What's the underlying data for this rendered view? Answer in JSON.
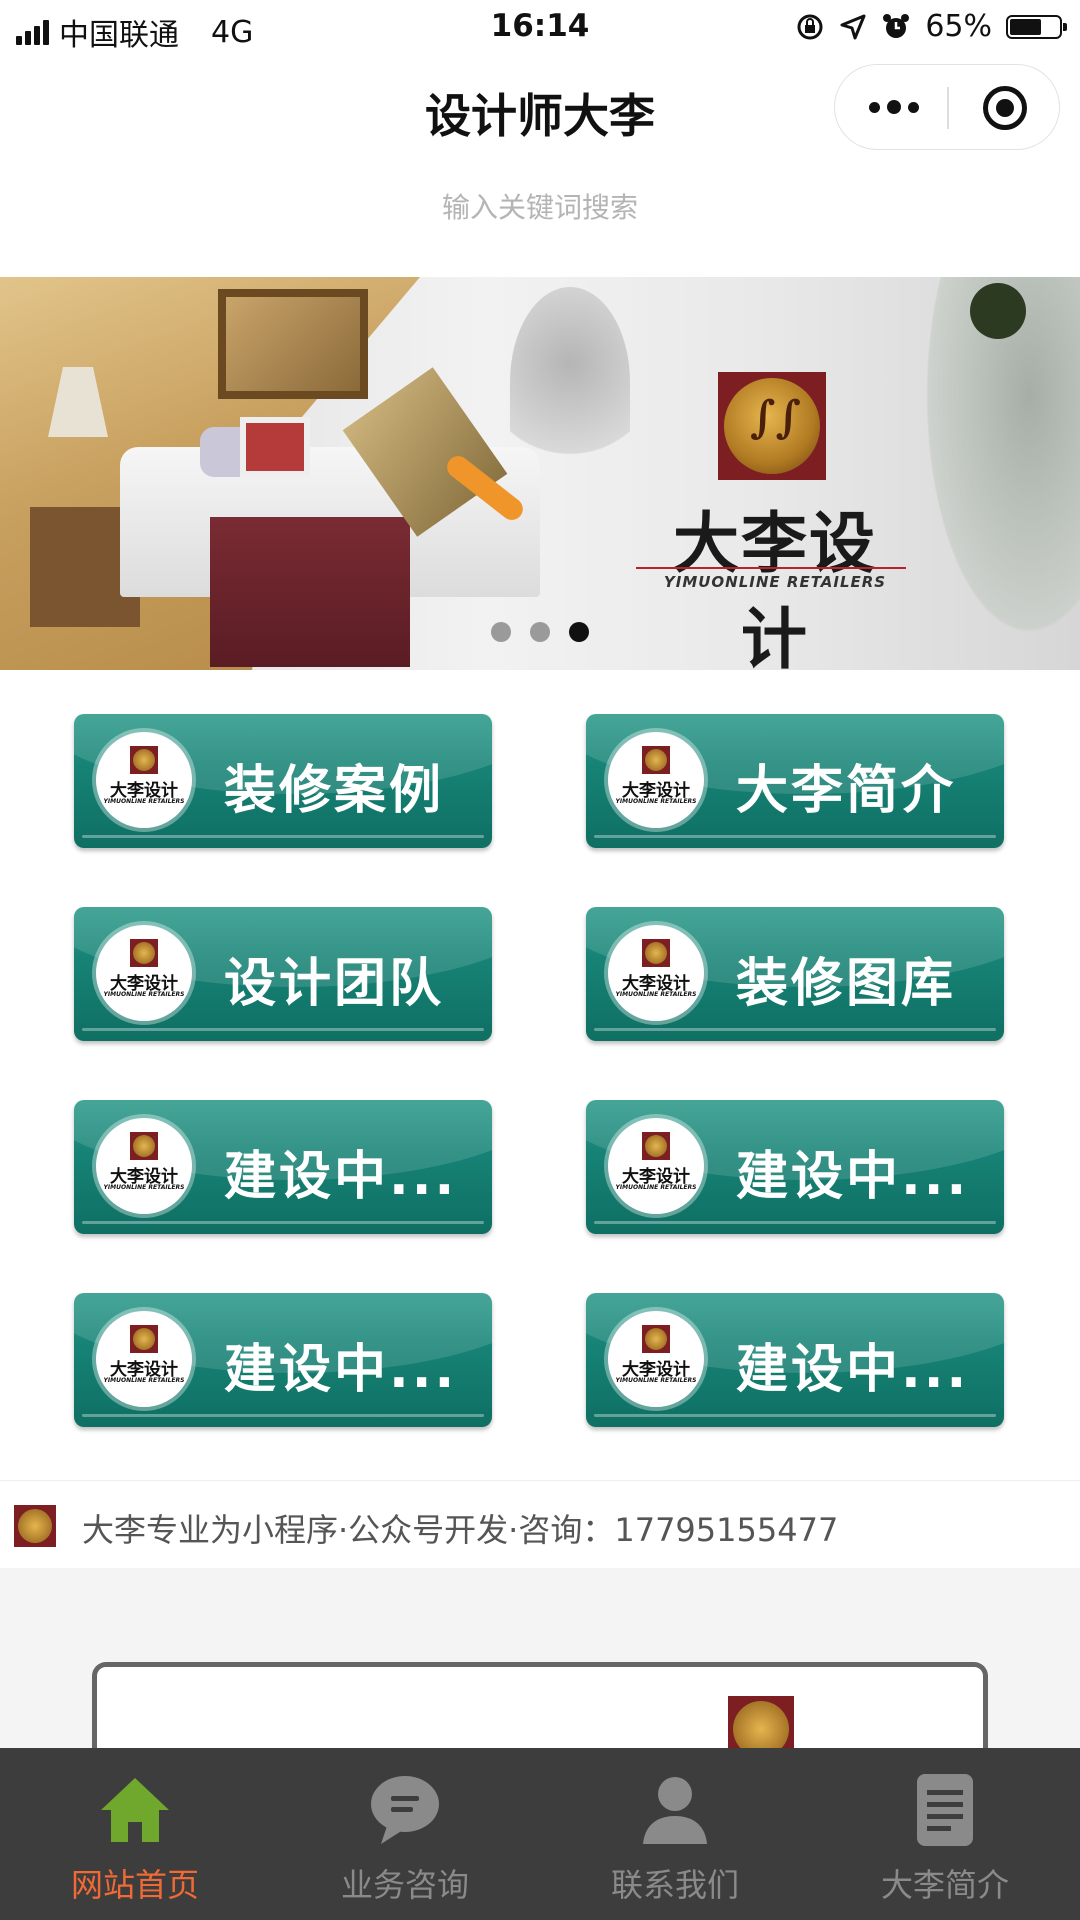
{
  "status_bar": {
    "carrier": "中国联通",
    "network": "4G",
    "time": "16:14",
    "battery": "65%",
    "battery_level": 0.65
  },
  "nav": {
    "title": "设计师大李"
  },
  "search": {
    "placeholder": "输入关键词搜索"
  },
  "banner": {
    "brand": "大李设计",
    "sub": "YIMUONLINE RETAILERS",
    "pages": 3,
    "active_page": 3
  },
  "tiles": [
    {
      "label": "装修案例",
      "logo_text": "大李设计",
      "logo_sub": "YIMUONLINE RETAILERS"
    },
    {
      "label": "大李简介",
      "logo_text": "大李设计",
      "logo_sub": "YIMUONLINE RETAILERS"
    },
    {
      "label": "设计团队",
      "logo_text": "大李设计",
      "logo_sub": "YIMUONLINE RETAILERS"
    },
    {
      "label": "装修图库",
      "logo_text": "大李设计",
      "logo_sub": "YIMUONLINE RETAILERS"
    },
    {
      "label": "建设中...",
      "logo_text": "大李设计",
      "logo_sub": "YIMUONLINE RETAILERS"
    },
    {
      "label": "建设中...",
      "logo_text": "大李设计",
      "logo_sub": "YIMUONLINE RETAILERS"
    },
    {
      "label": "建设中...",
      "logo_text": "大李设计",
      "logo_sub": "YIMUONLINE RETAILERS"
    },
    {
      "label": "建设中...",
      "logo_text": "大李设计",
      "logo_sub": "YIMUONLINE RETAILERS"
    }
  ],
  "notice": {
    "text": "大李专业为小程序·公众号开发·咨询：17795155477"
  },
  "tabbar": {
    "items": [
      {
        "label": "网站首页",
        "icon": "home-icon",
        "active": true
      },
      {
        "label": "业务咨询",
        "icon": "chat-bubble-icon",
        "active": false
      },
      {
        "label": "联系我们",
        "icon": "person-icon",
        "active": false
      },
      {
        "label": "大李简介",
        "icon": "document-icon",
        "active": false
      }
    ],
    "active_color": "#ef6a35",
    "active_icon_color": "#6fa82c"
  }
}
